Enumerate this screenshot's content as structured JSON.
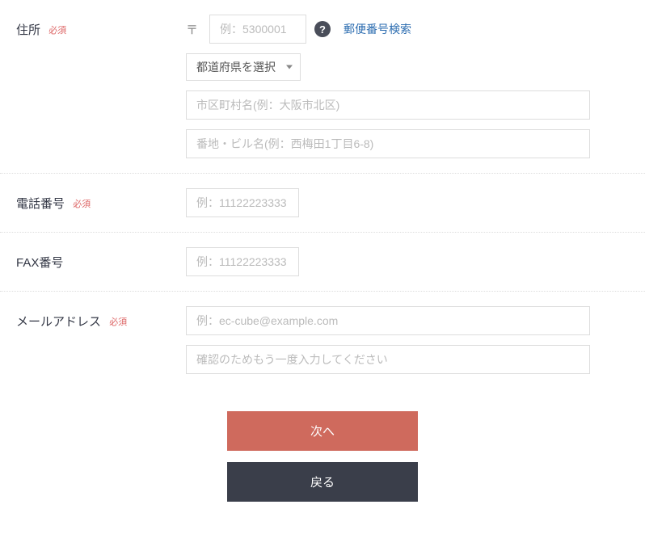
{
  "labels": {
    "address": "住所",
    "phone": "電話番号",
    "fax": "FAX番号",
    "email": "メールアドレス",
    "required": "必須"
  },
  "address": {
    "postal_mark": "〒",
    "postal_placeholder": "例：5300001",
    "zip_search_link": "郵便番号検索",
    "prefecture_selected": "都道府県を選択",
    "city_placeholder": "市区町村名(例：大阪市北区)",
    "street_placeholder": "番地・ビル名(例：西梅田1丁目6-8)"
  },
  "phone": {
    "placeholder": "例：11122223333"
  },
  "fax": {
    "placeholder": "例：11122223333"
  },
  "email": {
    "placeholder": "例：ec-cube@example.com",
    "confirm_placeholder": "確認のためもう一度入力してください"
  },
  "buttons": {
    "next": "次へ",
    "back": "戻る"
  }
}
